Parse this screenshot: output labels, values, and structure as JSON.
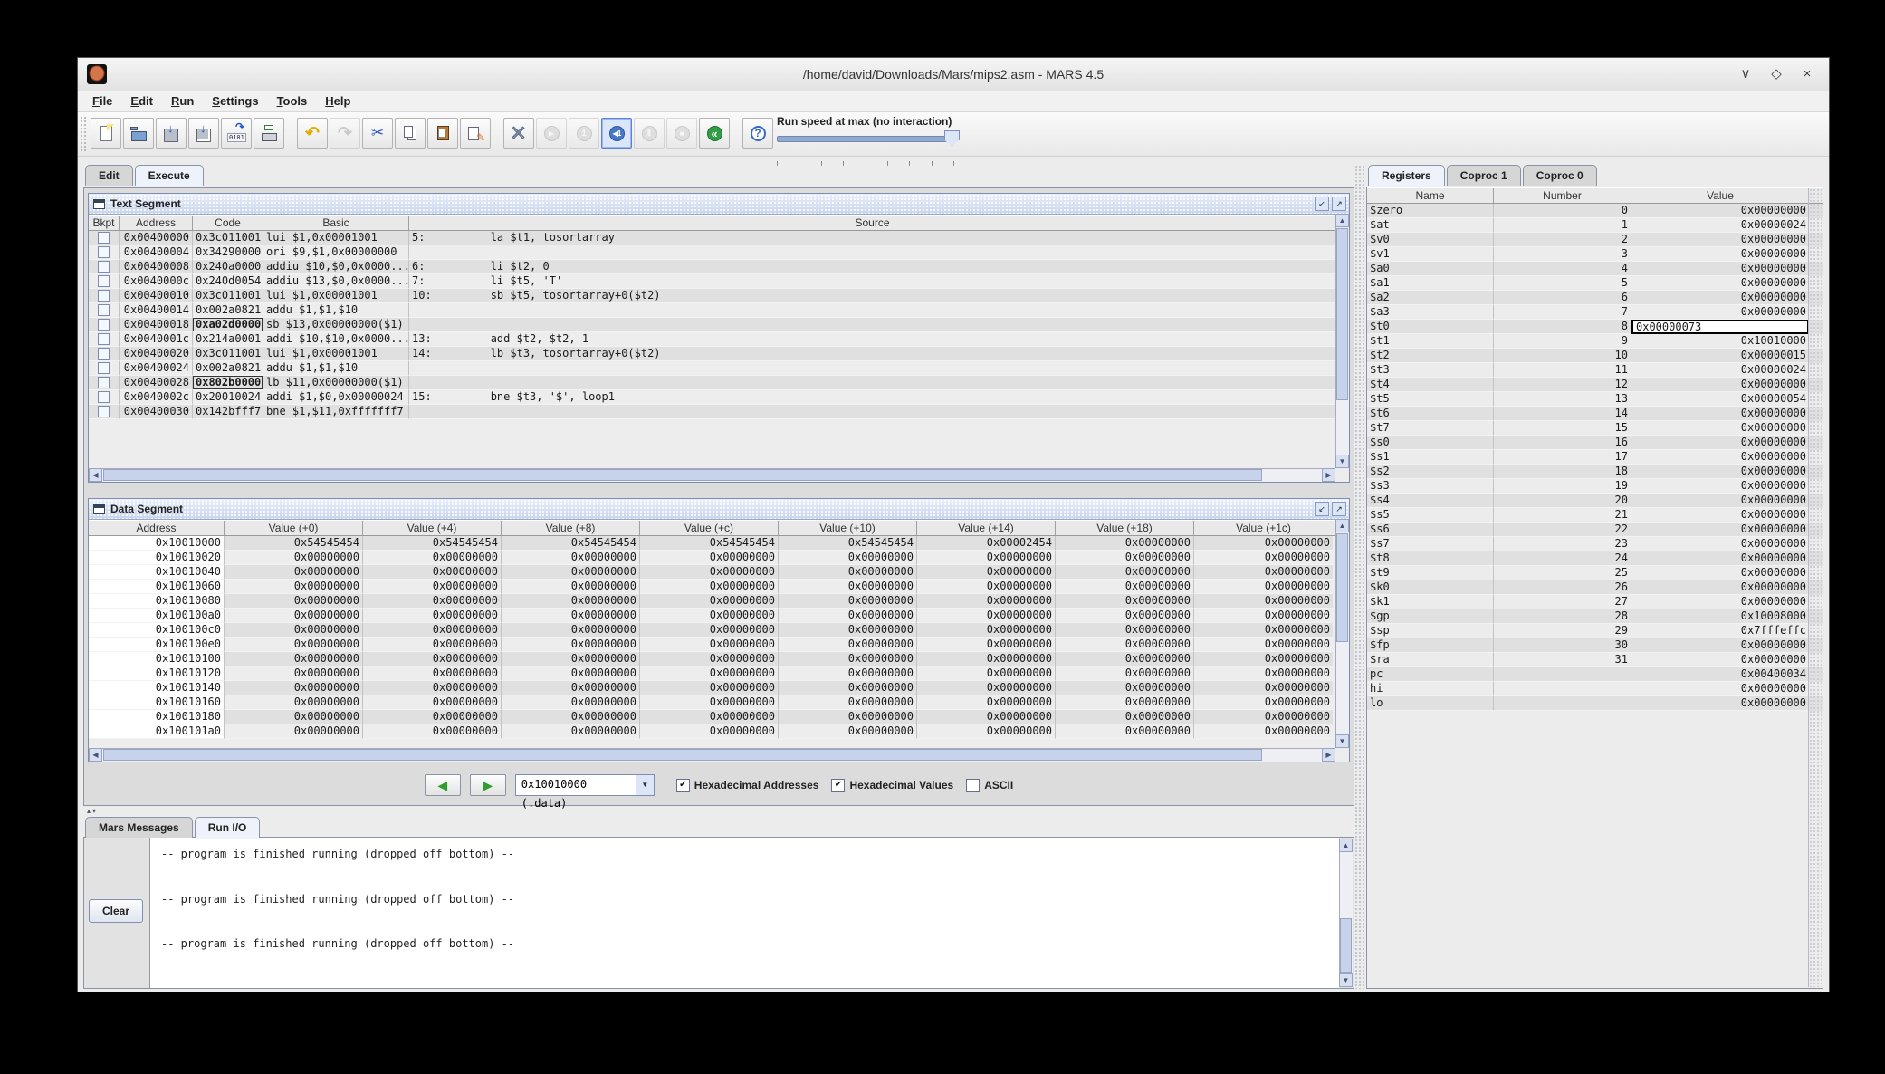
{
  "window": {
    "title": "/home/david/Downloads/Mars/mips2.asm - MARS 4.5",
    "controls": [
      {
        "name": "minimize",
        "glyph": "∨"
      },
      {
        "name": "maximize",
        "glyph": "◇"
      },
      {
        "name": "close",
        "glyph": "×"
      }
    ]
  },
  "menu": {
    "items": [
      {
        "label": "File"
      },
      {
        "label": "Edit"
      },
      {
        "label": "Run"
      },
      {
        "label": "Settings"
      },
      {
        "label": "Tools"
      },
      {
        "label": "Help"
      }
    ]
  },
  "toolbar": {
    "speed_label": "Run speed at max (no interaction)",
    "group1": [
      {
        "icon": "new-file",
        "disabled": false
      },
      {
        "icon": "open-file",
        "disabled": false
      },
      {
        "icon": "save-file",
        "disabled": false
      },
      {
        "icon": "save-as-file",
        "disabled": false
      },
      {
        "icon": "dump-memory",
        "disabled": false
      },
      {
        "icon": "print",
        "disabled": false
      }
    ],
    "group2": [
      {
        "icon": "undo",
        "disabled": false
      },
      {
        "icon": "redo",
        "disabled": true
      },
      {
        "icon": "cut",
        "disabled": false
      },
      {
        "icon": "copy",
        "disabled": false
      },
      {
        "icon": "paste",
        "disabled": false
      },
      {
        "icon": "find-replace",
        "disabled": false
      }
    ],
    "group3": [
      {
        "icon": "assemble",
        "disabled": false
      },
      {
        "icon": "run",
        "disabled": true
      },
      {
        "icon": "step-forward",
        "disabled": true
      },
      {
        "icon": "step-backward",
        "disabled": false,
        "focused": true
      },
      {
        "icon": "pause",
        "disabled": true
      },
      {
        "icon": "stop",
        "disabled": true
      },
      {
        "icon": "reset",
        "disabled": false
      }
    ],
    "group4": [
      {
        "icon": "help",
        "disabled": false
      }
    ]
  },
  "main_tabs": [
    {
      "label": "Edit",
      "selected": false
    },
    {
      "label": "Execute",
      "selected": true
    }
  ],
  "text_segment": {
    "title": "Text Segment",
    "columns": [
      "Bkpt",
      "Address",
      "Code",
      "Basic",
      "Source"
    ],
    "rows": [
      {
        "address": "0x00400000",
        "code": "0x3c011001",
        "basic": "lui $1,0x00001001",
        "source": "5:          la $t1, tosortarray",
        "focus": false
      },
      {
        "address": "0x00400004",
        "code": "0x34290000",
        "basic": "ori $9,$1,0x00000000",
        "source": "",
        "focus": false
      },
      {
        "address": "0x00400008",
        "code": "0x240a0000",
        "basic": "addiu $10,$0,0x0000...",
        "source": "6:          li $t2, 0",
        "focus": false
      },
      {
        "address": "0x0040000c",
        "code": "0x240d0054",
        "basic": "addiu $13,$0,0x0000...",
        "source": "7:          li $t5, 'T'",
        "focus": false
      },
      {
        "address": "0x00400010",
        "code": "0x3c011001",
        "basic": "lui $1,0x00001001",
        "source": "10:         sb $t5, tosortarray+0($t2)",
        "focus": false
      },
      {
        "address": "0x00400014",
        "code": "0x002a0821",
        "basic": "addu $1,$1,$10",
        "source": "",
        "focus": false
      },
      {
        "address": "0x00400018",
        "code": "0xa02d0000",
        "basic": "sb $13,0x00000000($1)",
        "source": "",
        "focus": true
      },
      {
        "address": "0x0040001c",
        "code": "0x214a0001",
        "basic": "addi $10,$10,0x0000...",
        "source": "13:         add $t2, $t2, 1",
        "focus": false
      },
      {
        "address": "0x00400020",
        "code": "0x3c011001",
        "basic": "lui $1,0x00001001",
        "source": "14:         lb $t3, tosortarray+0($t2)",
        "focus": false
      },
      {
        "address": "0x00400024",
        "code": "0x002a0821",
        "basic": "addu $1,$1,$10",
        "source": "",
        "focus": false
      },
      {
        "address": "0x00400028",
        "code": "0x802b0000",
        "basic": "lb $11,0x00000000($1)",
        "source": "",
        "focus": true
      },
      {
        "address": "0x0040002c",
        "code": "0x20010024",
        "basic": "addi $1,$0,0x00000024",
        "source": "15:         bne $t3, '$', loop1",
        "focus": false
      },
      {
        "address": "0x00400030",
        "code": "0x142bfff7",
        "basic": "bne $1,$11,0xfffffff7",
        "source": "",
        "focus": false
      }
    ]
  },
  "data_segment": {
    "title": "Data Segment",
    "columns": [
      "Address",
      "Value (+0)",
      "Value (+4)",
      "Value (+8)",
      "Value (+c)",
      "Value (+10)",
      "Value (+14)",
      "Value (+18)",
      "Value (+1c)"
    ],
    "rows": [
      {
        "address": "0x10010000",
        "values": [
          "0x54545454",
          "0x54545454",
          "0x54545454",
          "0x54545454",
          "0x54545454",
          "0x00002454",
          "0x00000000",
          "0x00000000"
        ]
      },
      {
        "address": "0x10010020",
        "values": [
          "0x00000000",
          "0x00000000",
          "0x00000000",
          "0x00000000",
          "0x00000000",
          "0x00000000",
          "0x00000000",
          "0x00000000"
        ]
      },
      {
        "address": "0x10010040",
        "values": [
          "0x00000000",
          "0x00000000",
          "0x00000000",
          "0x00000000",
          "0x00000000",
          "0x00000000",
          "0x00000000",
          "0x00000000"
        ]
      },
      {
        "address": "0x10010060",
        "values": [
          "0x00000000",
          "0x00000000",
          "0x00000000",
          "0x00000000",
          "0x00000000",
          "0x00000000",
          "0x00000000",
          "0x00000000"
        ]
      },
      {
        "address": "0x10010080",
        "values": [
          "0x00000000",
          "0x00000000",
          "0x00000000",
          "0x00000000",
          "0x00000000",
          "0x00000000",
          "0x00000000",
          "0x00000000"
        ]
      },
      {
        "address": "0x100100a0",
        "values": [
          "0x00000000",
          "0x00000000",
          "0x00000000",
          "0x00000000",
          "0x00000000",
          "0x00000000",
          "0x00000000",
          "0x00000000"
        ]
      },
      {
        "address": "0x100100c0",
        "values": [
          "0x00000000",
          "0x00000000",
          "0x00000000",
          "0x00000000",
          "0x00000000",
          "0x00000000",
          "0x00000000",
          "0x00000000"
        ]
      },
      {
        "address": "0x100100e0",
        "values": [
          "0x00000000",
          "0x00000000",
          "0x00000000",
          "0x00000000",
          "0x00000000",
          "0x00000000",
          "0x00000000",
          "0x00000000"
        ]
      },
      {
        "address": "0x10010100",
        "values": [
          "0x00000000",
          "0x00000000",
          "0x00000000",
          "0x00000000",
          "0x00000000",
          "0x00000000",
          "0x00000000",
          "0x00000000"
        ]
      },
      {
        "address": "0x10010120",
        "values": [
          "0x00000000",
          "0x00000000",
          "0x00000000",
          "0x00000000",
          "0x00000000",
          "0x00000000",
          "0x00000000",
          "0x00000000"
        ]
      },
      {
        "address": "0x10010140",
        "values": [
          "0x00000000",
          "0x00000000",
          "0x00000000",
          "0x00000000",
          "0x00000000",
          "0x00000000",
          "0x00000000",
          "0x00000000"
        ]
      },
      {
        "address": "0x10010160",
        "values": [
          "0x00000000",
          "0x00000000",
          "0x00000000",
          "0x00000000",
          "0x00000000",
          "0x00000000",
          "0x00000000",
          "0x00000000"
        ]
      },
      {
        "address": "0x10010180",
        "values": [
          "0x00000000",
          "0x00000000",
          "0x00000000",
          "0x00000000",
          "0x00000000",
          "0x00000000",
          "0x00000000",
          "0x00000000"
        ]
      },
      {
        "address": "0x100101a0",
        "values": [
          "0x00000000",
          "0x00000000",
          "0x00000000",
          "0x00000000",
          "0x00000000",
          "0x00000000",
          "0x00000000",
          "0x00000000"
        ]
      }
    ],
    "footer": {
      "combo_value": "0x10010000 (.data)",
      "checkboxes": [
        {
          "label": "Hexadecimal Addresses",
          "checked": true
        },
        {
          "label": "Hexadecimal Values",
          "checked": true
        },
        {
          "label": "ASCII",
          "checked": false
        }
      ]
    }
  },
  "registers_panel": {
    "tabs": [
      {
        "label": "Registers",
        "selected": true
      },
      {
        "label": "Coproc 1",
        "selected": false
      },
      {
        "label": "Coproc 0",
        "selected": false
      }
    ],
    "columns": [
      "Name",
      "Number",
      "Value"
    ],
    "rows": [
      {
        "name": "$zero",
        "number": "0",
        "value": "0x00000000",
        "editing": false
      },
      {
        "name": "$at",
        "number": "1",
        "value": "0x00000024",
        "editing": false
      },
      {
        "name": "$v0",
        "number": "2",
        "value": "0x00000000",
        "editing": false
      },
      {
        "name": "$v1",
        "number": "3",
        "value": "0x00000000",
        "editing": false
      },
      {
        "name": "$a0",
        "number": "4",
        "value": "0x00000000",
        "editing": false
      },
      {
        "name": "$a1",
        "number": "5",
        "value": "0x00000000",
        "editing": false
      },
      {
        "name": "$a2",
        "number": "6",
        "value": "0x00000000",
        "editing": false
      },
      {
        "name": "$a3",
        "number": "7",
        "value": "0x00000000",
        "editing": false
      },
      {
        "name": "$t0",
        "number": "8",
        "value": "0x00000073",
        "editing": true
      },
      {
        "name": "$t1",
        "number": "9",
        "value": "0x10010000",
        "editing": false
      },
      {
        "name": "$t2",
        "number": "10",
        "value": "0x00000015",
        "editing": false
      },
      {
        "name": "$t3",
        "number": "11",
        "value": "0x00000024",
        "editing": false
      },
      {
        "name": "$t4",
        "number": "12",
        "value": "0x00000000",
        "editing": false
      },
      {
        "name": "$t5",
        "number": "13",
        "value": "0x00000054",
        "editing": false
      },
      {
        "name": "$t6",
        "number": "14",
        "value": "0x00000000",
        "editing": false
      },
      {
        "name": "$t7",
        "number": "15",
        "value": "0x00000000",
        "editing": false
      },
      {
        "name": "$s0",
        "number": "16",
        "value": "0x00000000",
        "editing": false
      },
      {
        "name": "$s1",
        "number": "17",
        "value": "0x00000000",
        "editing": false
      },
      {
        "name": "$s2",
        "number": "18",
        "value": "0x00000000",
        "editing": false
      },
      {
        "name": "$s3",
        "number": "19",
        "value": "0x00000000",
        "editing": false
      },
      {
        "name": "$s4",
        "number": "20",
        "value": "0x00000000",
        "editing": false
      },
      {
        "name": "$s5",
        "number": "21",
        "value": "0x00000000",
        "editing": false
      },
      {
        "name": "$s6",
        "number": "22",
        "value": "0x00000000",
        "editing": false
      },
      {
        "name": "$s7",
        "number": "23",
        "value": "0x00000000",
        "editing": false
      },
      {
        "name": "$t8",
        "number": "24",
        "value": "0x00000000",
        "editing": false
      },
      {
        "name": "$t9",
        "number": "25",
        "value": "0x00000000",
        "editing": false
      },
      {
        "name": "$k0",
        "number": "26",
        "value": "0x00000000",
        "editing": false
      },
      {
        "name": "$k1",
        "number": "27",
        "value": "0x00000000",
        "editing": false
      },
      {
        "name": "$gp",
        "number": "28",
        "value": "0x10008000",
        "editing": false
      },
      {
        "name": "$sp",
        "number": "29",
        "value": "0x7fffeffc",
        "editing": false
      },
      {
        "name": "$fp",
        "number": "30",
        "value": "0x00000000",
        "editing": false
      },
      {
        "name": "$ra",
        "number": "31",
        "value": "0x00000000",
        "editing": false
      },
      {
        "name": "pc",
        "number": "",
        "value": "0x00400034",
        "editing": false
      },
      {
        "name": "hi",
        "number": "",
        "value": "0x00000000",
        "editing": false
      },
      {
        "name": "lo",
        "number": "",
        "value": "0x00000000",
        "editing": false
      }
    ]
  },
  "messages": {
    "tabs": [
      {
        "label": "Mars Messages",
        "selected": false
      },
      {
        "label": "Run I/O",
        "selected": true
      }
    ],
    "clear_label": "Clear",
    "text": "-- program is finished running (dropped off bottom) --\n\n\n-- program is finished running (dropped off bottom) --\n\n\n-- program is finished running (dropped off bottom) --"
  },
  "colors": {
    "accent_blue": "#4a78c8",
    "frame_title_blue": "#c8d5ee",
    "row_stripe": "#e0e0e0",
    "enabled_green": "#2f9e44",
    "undo_yellow": "#e0ad00"
  }
}
